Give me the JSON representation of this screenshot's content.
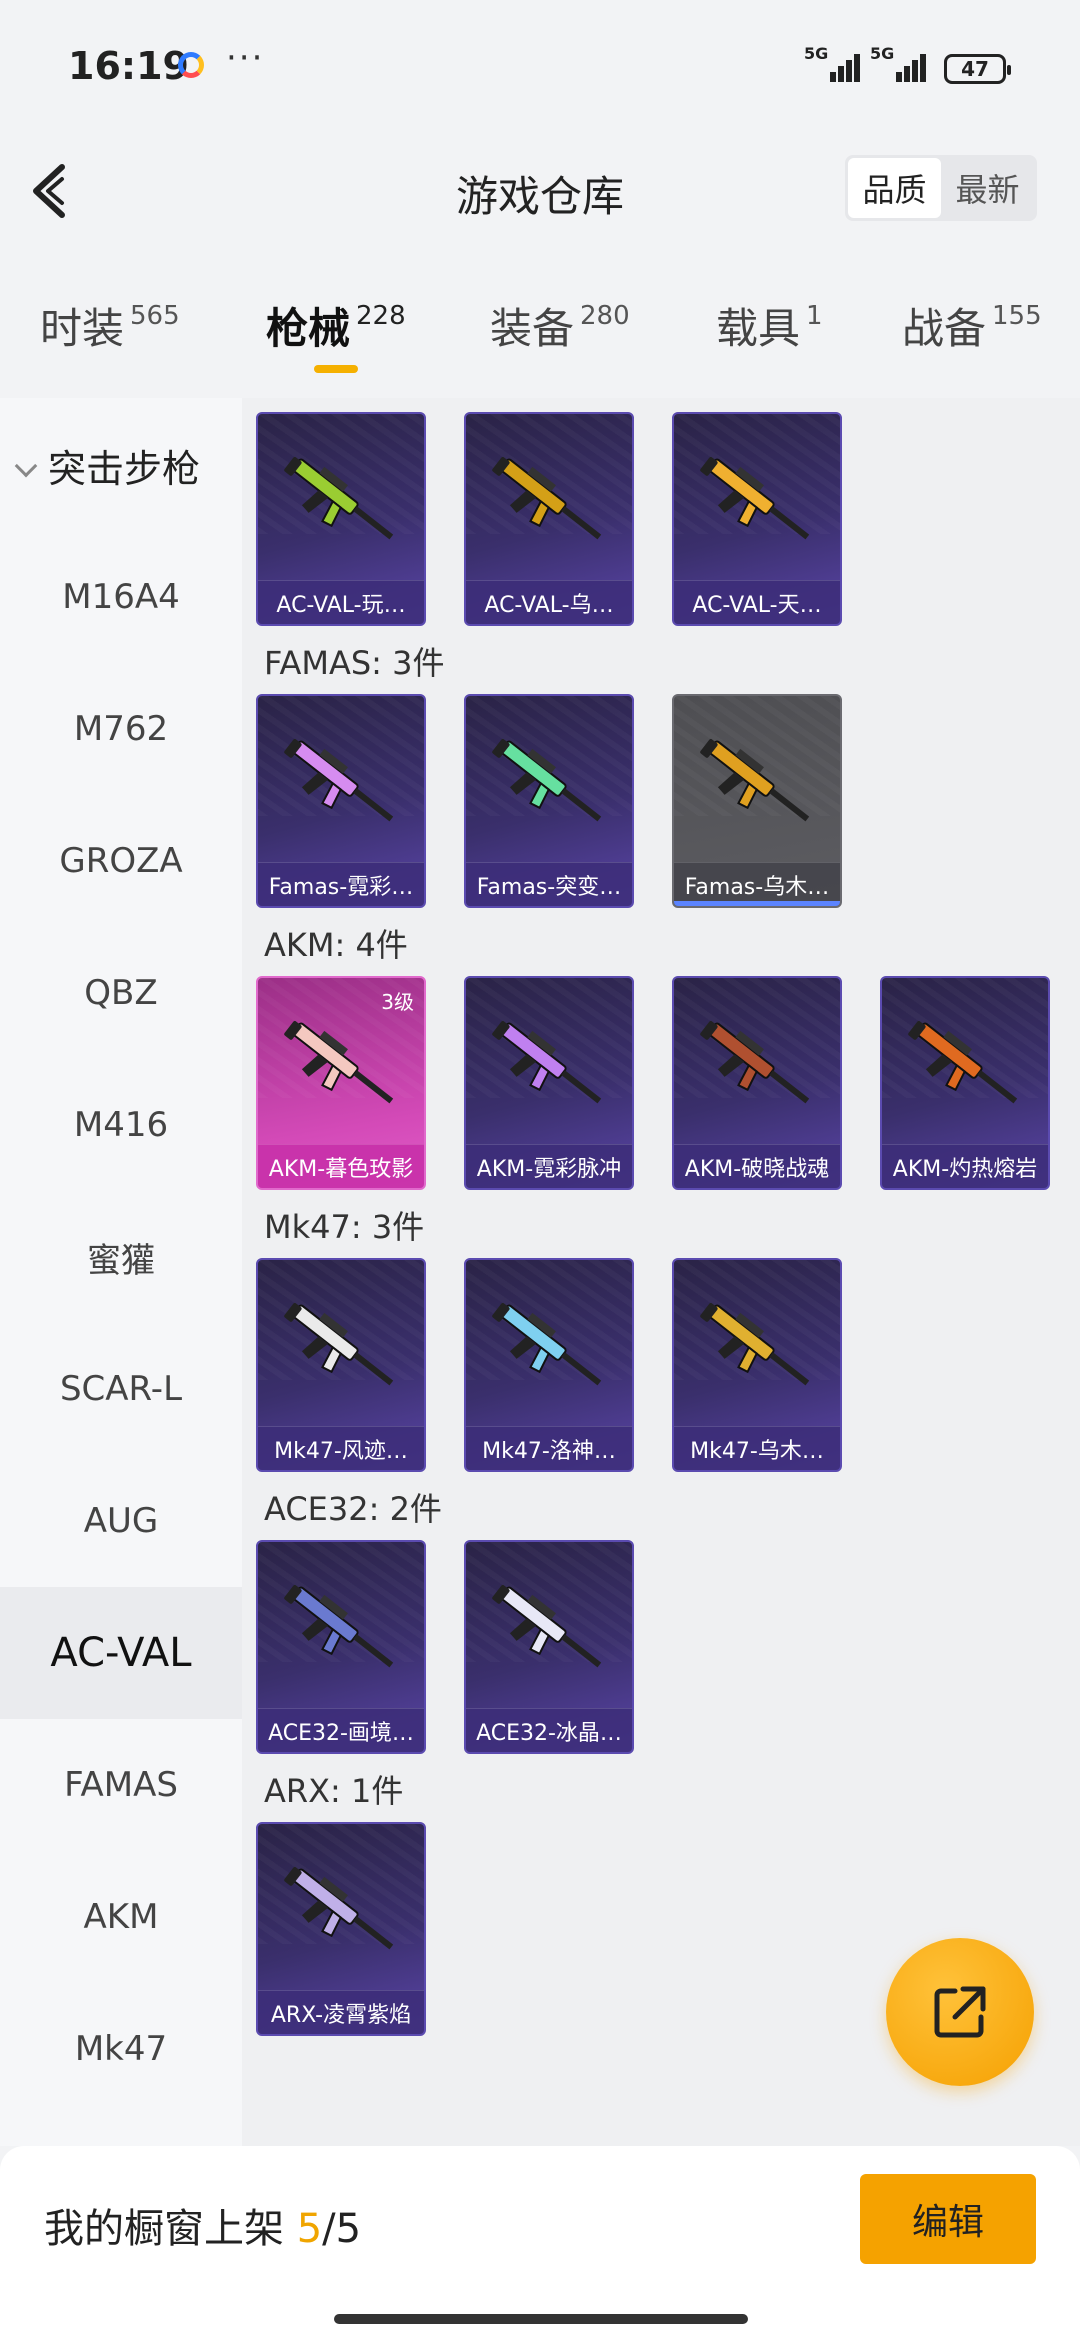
{
  "status": {
    "time": "16:19",
    "dots": "···",
    "signal1": "5G",
    "signal2": "5G",
    "battery": "47"
  },
  "header": {
    "title": "游戏仓库",
    "sort_quality": "品质",
    "sort_newest": "最新"
  },
  "tabs": [
    {
      "label": "时装",
      "count": "565"
    },
    {
      "label": "枪械",
      "count": "228"
    },
    {
      "label": "装备",
      "count": "280"
    },
    {
      "label": "载具",
      "count": "1"
    },
    {
      "label": "战备",
      "count": "155"
    }
  ],
  "sidebar": {
    "group": "突击步枪",
    "items": [
      "M16A4",
      "M762",
      "GROZA",
      "QBZ",
      "M416",
      "蜜獾",
      "SCAR-L",
      "AUG",
      "AC-VAL",
      "FAMAS",
      "AKM",
      "Mk47"
    ],
    "selected": "AC-VAL"
  },
  "sections": [
    {
      "title": "",
      "items": [
        {
          "name": "AC-VAL-玩…",
          "color": "#9acd32"
        },
        {
          "name": "AC-VAL-乌…",
          "color": "#d4a017"
        },
        {
          "name": "AC-VAL-天…",
          "color": "#f0b030"
        }
      ]
    },
    {
      "title": "FAMAS: 3件",
      "items": [
        {
          "name": "Famas-霓彩…",
          "color": "#d68cf0"
        },
        {
          "name": "Famas-突变…",
          "color": "#66e0a0"
        },
        {
          "name": "Famas-乌木…",
          "color": "#e0a020"
        }
      ]
    },
    {
      "title": "AKM: 4件",
      "items": [
        {
          "name": "AKM-暮色玫影",
          "color": "#f4c8c0",
          "level": "3级"
        },
        {
          "name": "AKM-霓彩脉冲",
          "color": "#c080f0"
        },
        {
          "name": "AKM-破晓战魂",
          "color": "#b05030"
        },
        {
          "name": "AKM-灼热熔岩",
          "color": "#e06a20"
        }
      ]
    },
    {
      "title": "Mk47: 3件",
      "items": [
        {
          "name": "Mk47-风迹…",
          "color": "#eaeaea"
        },
        {
          "name": "Mk47-洛神…",
          "color": "#7fd0f0"
        },
        {
          "name": "Mk47-乌木…",
          "color": "#e0b030"
        }
      ]
    },
    {
      "title": "ACE32: 2件",
      "items": [
        {
          "name": "ACE32-画境…",
          "color": "#6a7ad0"
        },
        {
          "name": "ACE32-冰晶…",
          "color": "#e8e8f6"
        }
      ]
    },
    {
      "title": "ARX: 1件",
      "items": [
        {
          "name": "ARX-凌霄紫焰",
          "color": "#c0b0e8"
        }
      ]
    }
  ],
  "bottom": {
    "label": "我的橱窗上架 ",
    "current": "5",
    "total": "/5",
    "edit": "编辑"
  },
  "colors": {
    "accent": "#f5a200",
    "card_bg": "#3a2f6c"
  }
}
